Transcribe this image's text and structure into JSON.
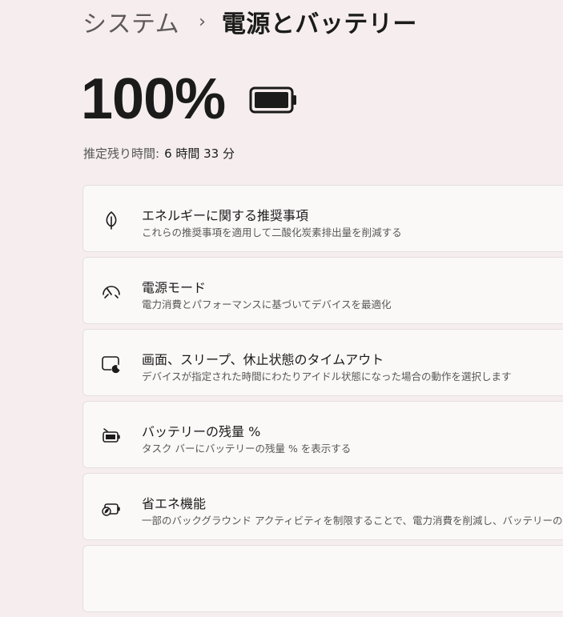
{
  "breadcrumb": {
    "parent": "システム",
    "separator": "›",
    "current": "電源とバッテリー"
  },
  "battery": {
    "percent_text": "100%",
    "level": 1.0,
    "icon": "battery-full-icon",
    "estimate_label": "推定残り時間:",
    "estimate_value": "6 時間 33 分"
  },
  "cards": [
    {
      "icon": "leaf-icon",
      "title": "エネルギーに関する推奨事項",
      "description": "これらの推奨事項を適用して二酸化炭素排出量を削減する"
    },
    {
      "icon": "gauge-icon",
      "title": "電源モード",
      "description": "電力消費とパフォーマンスに基づいてデバイスを最適化"
    },
    {
      "icon": "screen-sleep-icon",
      "title": "画面、スリープ、休止状態のタイムアウト",
      "description": "デバイスが指定された時間にわたりアイドル状態になった場合の動作を選択します"
    },
    {
      "icon": "battery-percentage-icon",
      "title": "バッテリーの残量 %",
      "description": "タスク バーにバッテリーの残量 % を表示する"
    },
    {
      "icon": "energy-saver-icon",
      "title": "省エネ機能",
      "description": "一部のバックグラウンド アクティビティを制限することで、電力消費を削減し、バッテリーの寿命"
    }
  ],
  "colors": {
    "background": "#f6eeee",
    "card": "#fbf8f8",
    "card_border": "#e6dfdf",
    "text_primary": "#1b1b1b",
    "text_secondary": "#5a5656"
  }
}
